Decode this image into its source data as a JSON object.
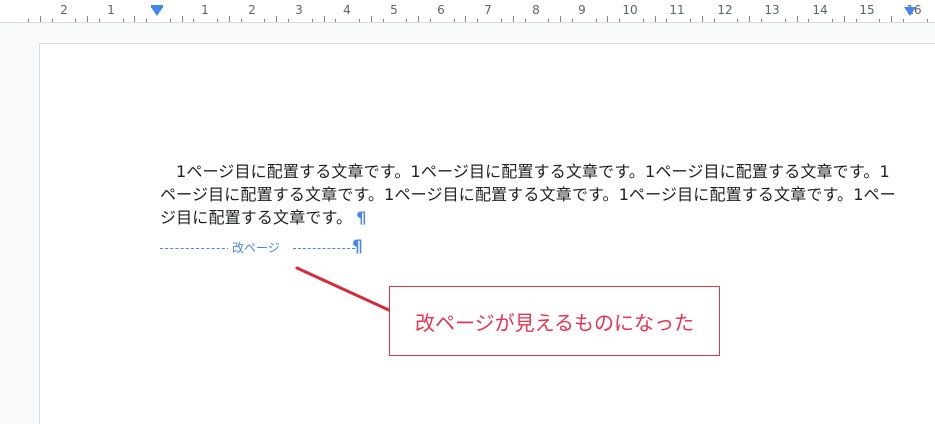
{
  "ruler": {
    "labels": [
      "2",
      "1",
      "1",
      "2",
      "3",
      "4",
      "5",
      "6",
      "7",
      "8",
      "9",
      "10",
      "11",
      "12",
      "13",
      "14",
      "15",
      "16"
    ]
  },
  "document": {
    "paragraph": "1ページ目に配置する文章です。1ページ目に配置する文章です。1ページ目に配置する文章です。1ページ目に配置する文章です。1ページ目に配置する文章です。1ページ目に配置する文章です。1ページ目に配置する文章です。",
    "pilcrow": "¶",
    "page_break_label": "改ページ",
    "page_break_pilcrow": "¶"
  },
  "annotation": {
    "text": "改ページが見えるものになった"
  },
  "colors": {
    "accent": "#4a86e8",
    "annotation": "#e53550",
    "ruler_marker": "#4285f4"
  }
}
